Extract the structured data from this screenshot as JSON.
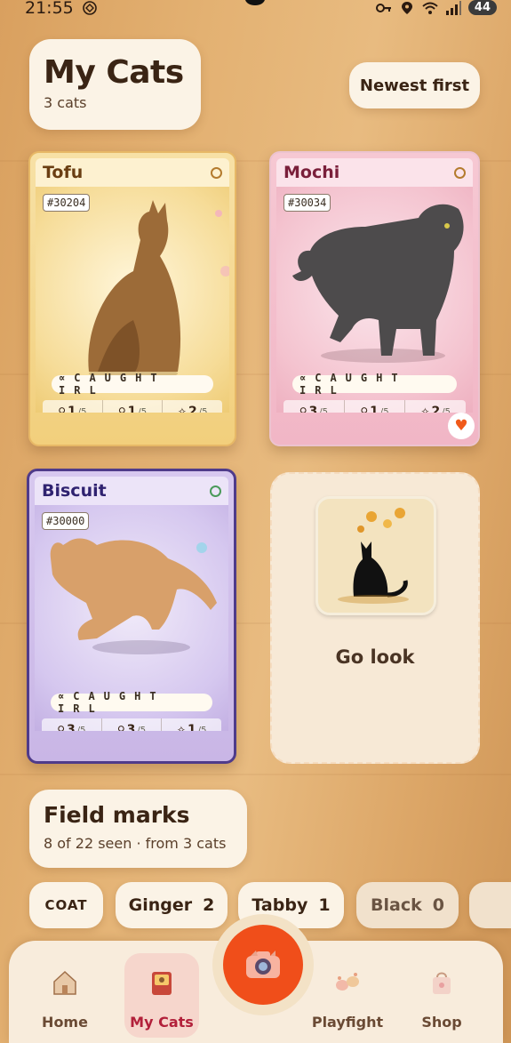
{
  "status": {
    "time": "21:55",
    "battery": "44"
  },
  "header": {
    "title": "My Cats",
    "count": "3 cats",
    "sort_label": "Newest first"
  },
  "cards": [
    {
      "name": "Tofu",
      "id": "#30204",
      "caught": "∝CAUGHT IRL",
      "stats": [
        {
          "value": "1",
          "max": "/5"
        },
        {
          "value": "1",
          "max": "/5"
        },
        {
          "value": "2",
          "max": "/5"
        }
      ]
    },
    {
      "name": "Mochi",
      "id": "#30034",
      "caught": "∝CAUGHT IRL",
      "stats": [
        {
          "value": "3",
          "max": "/5"
        },
        {
          "value": "1",
          "max": "/5"
        },
        {
          "value": "2",
          "max": "/5"
        }
      ]
    },
    {
      "name": "Biscuit",
      "id": "#30000",
      "caught": "∝CAUGHT IRL",
      "stats": [
        {
          "value": "3",
          "max": "/5"
        },
        {
          "value": "3",
          "max": "/5"
        },
        {
          "value": "1",
          "max": "/5"
        }
      ]
    }
  ],
  "go_look": {
    "label": "Go look"
  },
  "field_marks": {
    "title": "Field marks",
    "summary": "8 of 22 seen · from 3 cats"
  },
  "chips": [
    {
      "label": "COAT",
      "count": ""
    },
    {
      "label": "Ginger",
      "count": "2"
    },
    {
      "label": "Tabby",
      "count": "1"
    },
    {
      "label": "Black",
      "count": "0"
    }
  ],
  "nav": {
    "home": "Home",
    "my_cats": "My Cats",
    "playfight": "Playfight",
    "shop": "Shop"
  },
  "colors": {
    "accent": "#f04e1a",
    "active_nav": "#b2203a",
    "card_tofu": "#f2cf7c",
    "card_mochi": "#f1b6c6",
    "card_biscuit": "#c9b6e6"
  },
  "icons": [
    "key-icon",
    "location-icon",
    "wifi-icon",
    "signal-icon",
    "camera-icon",
    "heart-icon"
  ]
}
